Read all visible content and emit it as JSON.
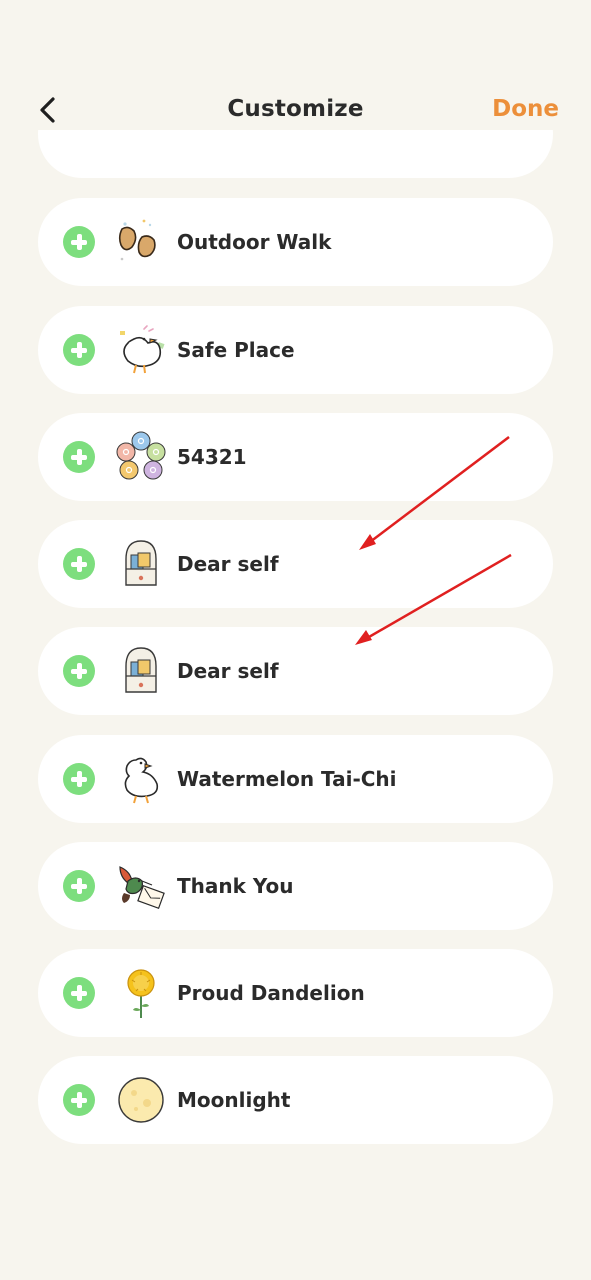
{
  "header": {
    "title": "Customize",
    "done_label": "Done",
    "back_icon": "chevron-left-icon"
  },
  "items": [
    {
      "label": "Outdoor Walk",
      "icon": "footprints-icon"
    },
    {
      "label": "Safe Place",
      "icon": "goose-icon"
    },
    {
      "label": "54321",
      "icon": "five-circles-icon"
    },
    {
      "label": "Dear self",
      "icon": "letter-jar-icon"
    },
    {
      "label": "Dear self",
      "icon": "letter-jar-icon"
    },
    {
      "label": "Watermelon Tai-Chi",
      "icon": "goose-icon"
    },
    {
      "label": "Thank You",
      "icon": "hummingbird-letter-icon"
    },
    {
      "label": "Proud Dandelion",
      "icon": "dandelion-icon"
    },
    {
      "label": "Moonlight",
      "icon": "moon-icon"
    }
  ],
  "colors": {
    "background": "#f7f5ee",
    "card": "#ffffff",
    "accent_done": "#ec8f3a",
    "add_button": "#7dde7e",
    "annotation_arrow": "#e02020"
  }
}
